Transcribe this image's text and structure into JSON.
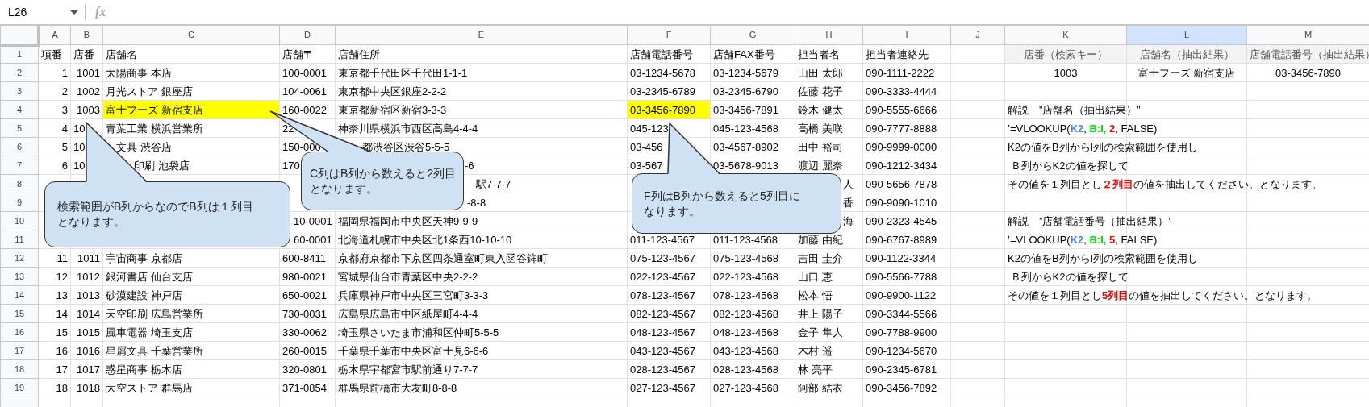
{
  "formula_bar": {
    "name_box": "L26",
    "fx": "fx"
  },
  "columns": [
    {
      "letter": "A",
      "selected": false
    },
    {
      "letter": "B",
      "selected": false
    },
    {
      "letter": "C",
      "selected": false
    },
    {
      "letter": "D",
      "selected": false
    },
    {
      "letter": "E",
      "selected": false
    },
    {
      "letter": "F",
      "selected": false
    },
    {
      "letter": "G",
      "selected": false
    },
    {
      "letter": "H",
      "selected": false
    },
    {
      "letter": "I",
      "selected": false
    },
    {
      "letter": "J",
      "selected": false
    },
    {
      "letter": "K",
      "selected": false
    },
    {
      "letter": "L",
      "selected": true
    },
    {
      "letter": "M",
      "selected": false
    }
  ],
  "rows": [
    {
      "number": "1",
      "kind": "header",
      "cells": [
        "項番",
        "店番",
        "店舗名",
        "店舗〒",
        "店舗住所",
        "店舗電話番号",
        "店舗FAX番号",
        "担当者名",
        "担当者連絡先",
        null,
        {
          "kind": "label",
          "text": "店番（検索キー）"
        },
        {
          "kind": "label",
          "text": "店舗名（抽出結果）"
        },
        {
          "kind": "label",
          "text": "店舗電話番号（抽出結果）"
        }
      ]
    },
    {
      "number": "2",
      "cells": [
        "1",
        "1001",
        "太陽商事 本店",
        "100-0001",
        "東京都千代田区千代田1-1-1",
        "03-1234-5678",
        "03-1234-5679",
        "山田 太郎",
        "090-1111-2222",
        null,
        {
          "kind": "result",
          "text": "1003"
        },
        {
          "kind": "result",
          "text": "富士フーズ 新宿支店"
        },
        {
          "kind": "result",
          "text": "03-3456-7890"
        }
      ]
    },
    {
      "number": "3",
      "cells": [
        "2",
        "1002",
        "月光ストア 銀座店",
        "104-0061",
        "東京都中央区銀座2-2-2",
        "03-2345-6789",
        "03-2345-6790",
        "佐藤 花子",
        "090-3333-4444"
      ]
    },
    {
      "number": "4",
      "cells": [
        "3",
        "1003",
        {
          "text": "富士フーズ 新宿支店",
          "highlighted": true
        },
        "160-0022",
        "東京都新宿区新宿3-3-3",
        {
          "text": "03-3456-7890",
          "highlighted": true
        },
        "03-3456-7891",
        "鈴木 健太",
        "090-5555-6666",
        null,
        {
          "kind": "note",
          "segments": [
            {
              "text": "解説　”店舗名（抽出結果）”"
            }
          ]
        }
      ]
    },
    {
      "number": "5",
      "cells": [
        "4",
        "10",
        "青葉工業 横浜営業所",
        "22",
        "神奈川県横浜市西区高島4-4-4",
        "045-123",
        "045-123-4568",
        "高橋 美咲",
        "090-7777-8888",
        null,
        {
          "kind": "note",
          "segments": [
            {
              "text": "’=VLOOKUP("
            },
            {
              "text": "K2",
              "color": "#4a86e8"
            },
            {
              "text": ", "
            },
            {
              "text": "B:I, ",
              "color": "#00dd00"
            },
            {
              "text": "2",
              "color": "#ff0000"
            },
            {
              "text": ", FALSE)"
            }
          ]
        }
      ]
    },
    {
      "number": "6",
      "cells": [
        "5",
        "10",
        "文具 渋谷店",
        "150-000",
        "都渋谷区渋谷5-5-5",
        "03-456",
        "03-4567-8902",
        "田中 裕司",
        "090-9999-0000",
        null,
        {
          "kind": "note",
          "segments": [
            {
              "text": "K2の値をB列からI列の検索範囲を使用し"
            }
          ]
        }
      ]
    },
    {
      "number": "7",
      "cells": [
        "6",
        "10",
        "印刷 池袋店",
        "170",
        "-6",
        "03-567",
        "03-5678-9013",
        "渡辺 麗奈",
        "090-1212-3434",
        null,
        {
          "kind": "note",
          "segments": [
            {
              "text": " Ｂ列からK2の値を探して"
            }
          ]
        }
      ]
    },
    {
      "number": "8",
      "cells": [
        null,
        null,
        null,
        null,
        "駅7-7-7",
        null,
        null,
        "人",
        "090-5656-7878",
        null,
        {
          "kind": "note",
          "segments": [
            {
              "text": "その値を１列目とし"
            },
            {
              "text": "２列目",
              "color": "#ff0000"
            },
            {
              "text": "の値を抽出してください。となります。"
            }
          ]
        }
      ]
    },
    {
      "number": "9",
      "cells": [
        null,
        null,
        null,
        null,
        "-8-8",
        null,
        null,
        "香",
        "090-9090-1010"
      ]
    },
    {
      "number": "10",
      "cells": [
        null,
        null,
        null,
        "10-0001",
        "福岡県福岡市中央区天神9-9-9",
        null,
        null,
        "海",
        "090-2323-4545",
        null,
        {
          "kind": "note",
          "segments": [
            {
              "text": "解説　”店舗電話番号（抽出結果）”"
            }
          ]
        }
      ]
    },
    {
      "number": "11",
      "cells": [
        null,
        null,
        null,
        "60-0001",
        "北海道札幌市中央区北1条西10-10-10",
        "011-123-4567",
        "011-123-4568",
        "加藤 由紀",
        "090-6767-8989",
        null,
        {
          "kind": "note",
          "segments": [
            {
              "text": "’=VLOOKUP("
            },
            {
              "text": "K2",
              "color": "#4a86e8"
            },
            {
              "text": ", "
            },
            {
              "text": "B:I, ",
              "color": "#00dd00"
            },
            {
              "text": "5",
              "color": "#ff0000"
            },
            {
              "text": ", FALSE)"
            }
          ]
        }
      ]
    },
    {
      "number": "12",
      "cells": [
        "11",
        "1011",
        "宇宙商事 京都店",
        "600-8411",
        "京都府京都市下京区四条通室町東入函谷鉾町",
        "075-123-4567",
        "075-123-4568",
        "吉田 圭介",
        "090-1122-3344",
        null,
        {
          "kind": "note",
          "segments": [
            {
              "text": "K2の値をB列からI列の検索範囲を使用し"
            }
          ]
        }
      ]
    },
    {
      "number": "13",
      "cells": [
        "12",
        "1012",
        "銀河書店 仙台支店",
        "980-0021",
        "宮城県仙台市青葉区中央2-2-2",
        "022-123-4567",
        "022-123-4568",
        "山口 恵",
        "090-5566-7788",
        null,
        {
          "kind": "note",
          "segments": [
            {
              "text": " Ｂ列からK2の値を探して"
            }
          ]
        }
      ]
    },
    {
      "number": "14",
      "cells": [
        "13",
        "1013",
        "砂漠建設 神戸店",
        "650-0021",
        "兵庫県神戸市中央区三宮町3-3-3",
        "078-123-4567",
        "078-123-4568",
        "松本 悟",
        "090-9900-1122",
        null,
        {
          "kind": "note",
          "segments": [
            {
              "text": "その値を１列目とし"
            },
            {
              "text": "5列目",
              "color": "#ff0000"
            },
            {
              "text": "の値を抽出してください。となります。"
            }
          ]
        }
      ]
    },
    {
      "number": "15",
      "cells": [
        "14",
        "1014",
        "天空印刷 広島営業所",
        "730-0031",
        "広島県広島市中区紙屋町4-4-4",
        "082-123-4567",
        "082-123-4568",
        "井上 陽子",
        "090-3344-5566"
      ]
    },
    {
      "number": "16",
      "cells": [
        "15",
        "1015",
        "風車電器 埼玉支店",
        "330-0062",
        "埼玉県さいたま市浦和区仲町5-5-5",
        "048-123-4567",
        "048-123-4568",
        "金子 隼人",
        "090-7788-9900"
      ]
    },
    {
      "number": "17",
      "cells": [
        "16",
        "1016",
        "星屑文具 千葉営業所",
        "260-0015",
        "千葉県千葉市中央区富士見6-6-6",
        "043-123-4567",
        "043-123-4568",
        "木村 遥",
        "090-1234-5670"
      ]
    },
    {
      "number": "18",
      "cells": [
        "17",
        "1017",
        "惑星商事 栃木店",
        "320-0801",
        "栃木県宇都宮市駅前通り7-7-7",
        "028-123-4567",
        "028-123-4568",
        "林 亮平",
        "090-2345-6781"
      ]
    },
    {
      "number": "19",
      "cells": [
        "18",
        "1018",
        "大空ストア 群馬店",
        "371-0854",
        "群馬県前橋市大友町8-8-8",
        "027-123-4567",
        "027-123-4568",
        "阿部 結衣",
        "090-3456-7892"
      ]
    }
  ],
  "callouts": [
    {
      "text": "検索範囲がB列からなのでB列は１列目となります。"
    },
    {
      "text": "C列はB列から数えると2列目となります。"
    },
    {
      "text": "F列はB列から数えると5列目になります。"
    }
  ]
}
